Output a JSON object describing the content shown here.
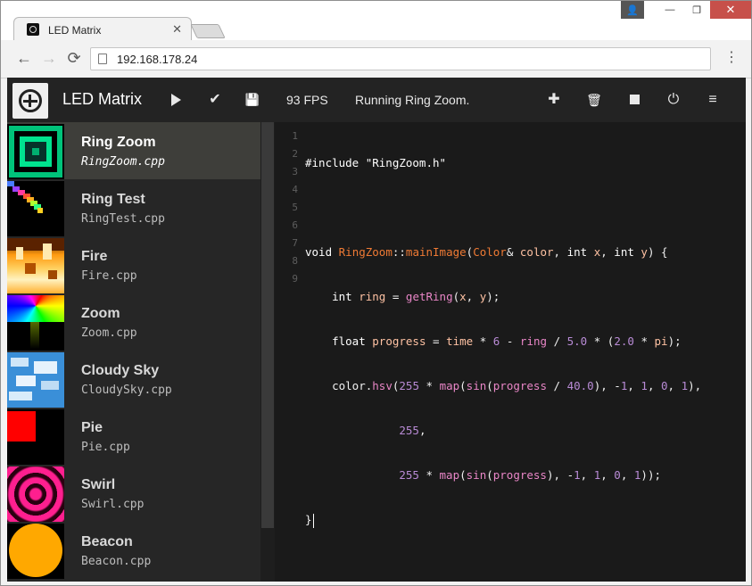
{
  "browser": {
    "tab_title": "LED Matrix",
    "tab_close": "✕",
    "url": "192.168.178.24",
    "window_controls": {
      "user": "👤",
      "minimize": "—",
      "restore": "❐",
      "close": "✕"
    },
    "nav": {
      "back": "←",
      "forward": "→",
      "reload": "⟳",
      "menu": "⋮"
    }
  },
  "toolbar": {
    "title": "LED Matrix",
    "fps": "93 FPS",
    "status": "Running Ring Zoom.",
    "icons": [
      "play-icon",
      "check-icon",
      "save-icon",
      "plus-icon",
      "trash-icon",
      "stop-icon",
      "power-icon",
      "list-icon"
    ],
    "glyphs": {
      "check": "✔",
      "save": "💾",
      "plus": "✚",
      "trash": "🗑",
      "power": "⏻",
      "list": "≡"
    }
  },
  "sidebar": {
    "items": [
      {
        "name": "Ring Zoom",
        "file": "RingZoom.cpp",
        "active": true
      },
      {
        "name": "Ring Test",
        "file": "RingTest.cpp",
        "active": false
      },
      {
        "name": "Fire",
        "file": "Fire.cpp",
        "active": false
      },
      {
        "name": "Zoom",
        "file": "Zoom.cpp",
        "active": false
      },
      {
        "name": "Cloudy Sky",
        "file": "CloudySky.cpp",
        "active": false
      },
      {
        "name": "Pie",
        "file": "Pie.cpp",
        "active": false
      },
      {
        "name": "Swirl",
        "file": "Swirl.cpp",
        "active": false
      },
      {
        "name": "Beacon",
        "file": "Beacon.cpp",
        "active": false
      }
    ]
  },
  "editor": {
    "line_numbers": [
      "1",
      "2",
      "3",
      "4",
      "5",
      "6",
      "7",
      "8",
      "9"
    ],
    "lines": [
      "#include \"RingZoom.h\"",
      "",
      "void RingZoom::mainImage(Color& color, int x, int y) {",
      "    int ring = getRing(x, y);",
      "    float progress = time * 6 - ring / 5.0 * (2.0 * pi);",
      "    color.hsv(255 * map(sin(progress / 40.0), -1, 1, 0, 1),",
      "              255,",
      "              255 * map(sin(progress), -1, 1, 0, 1));",
      "}"
    ]
  },
  "colors": {
    "app_bg": "#1a1a1a",
    "toolbar_bg": "#232323",
    "sidebar_bg": "#262626",
    "active_item_bg": "#3e3e3a",
    "code_function": "#ef7a34",
    "code_call": "#e986c7",
    "code_number": "#b98bd6",
    "code_variable": "#ffc2a3"
  }
}
